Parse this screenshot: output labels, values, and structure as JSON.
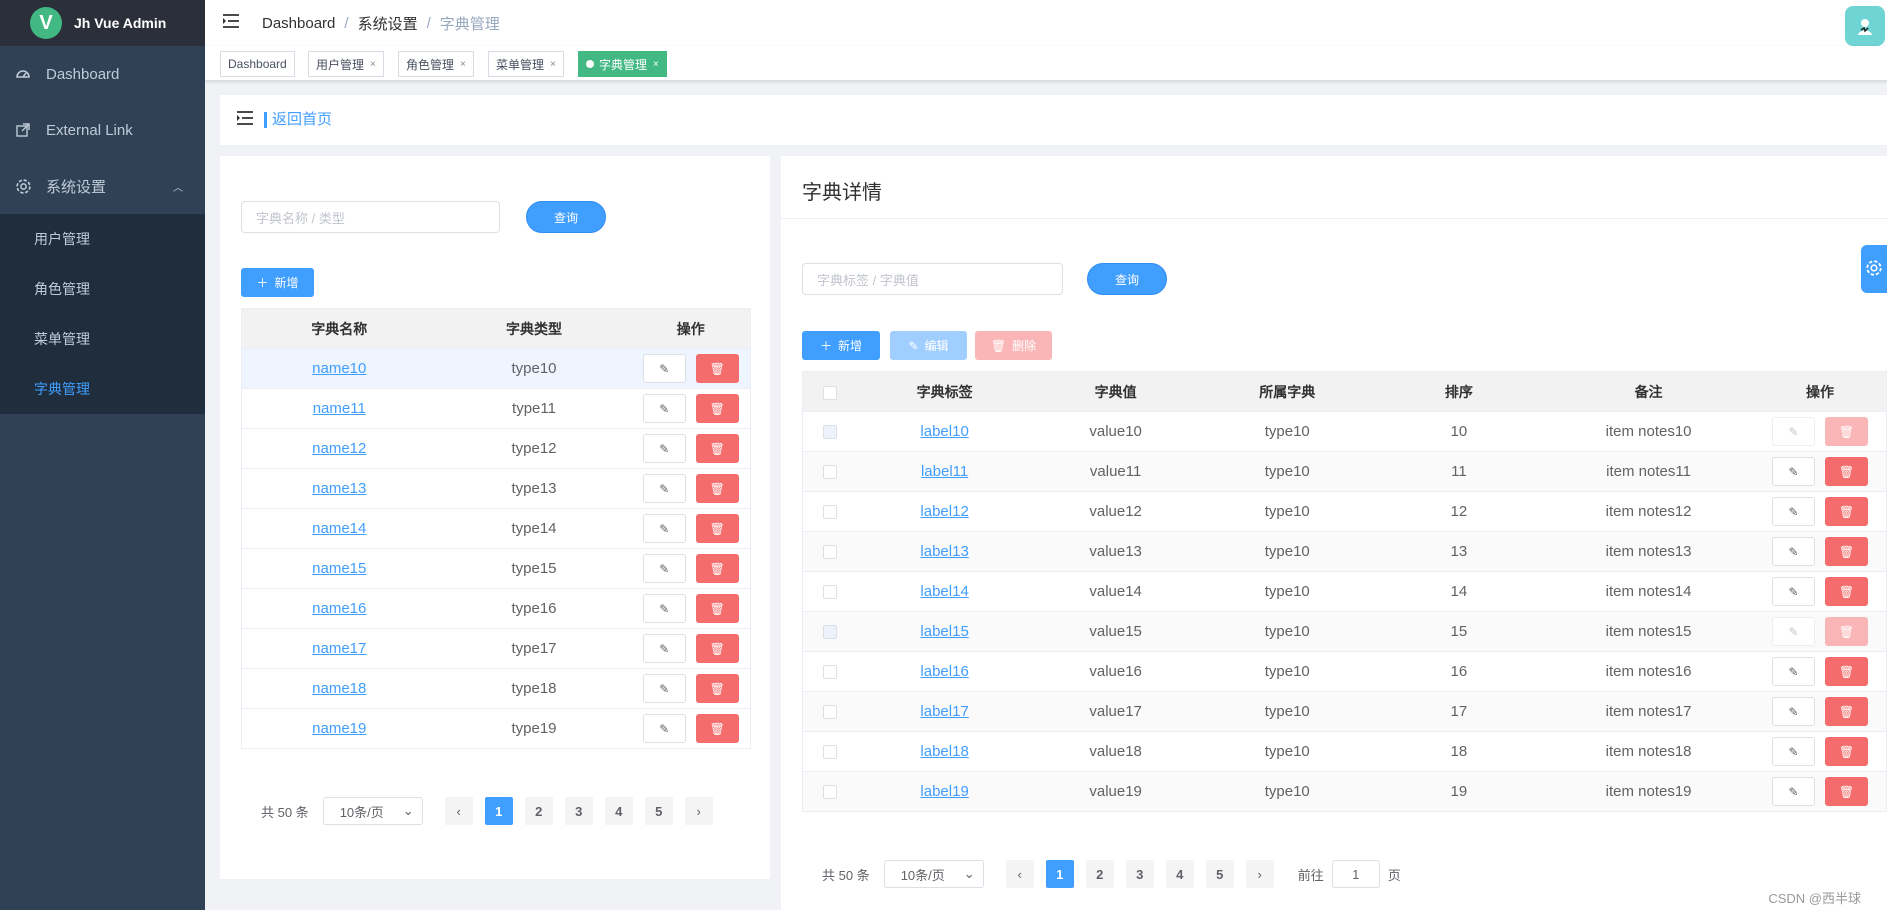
{
  "app": {
    "title": "Jh Vue Admin",
    "logo_letter": "V"
  },
  "sidebar": {
    "items": [
      {
        "label": "Dashboard",
        "icon": "dashboard-icon"
      },
      {
        "label": "External Link",
        "icon": "external-link-icon"
      },
      {
        "label": "系统设置",
        "icon": "gear-icon"
      }
    ],
    "submenu": [
      {
        "label": "用户管理"
      },
      {
        "label": "角色管理"
      },
      {
        "label": "菜单管理"
      },
      {
        "label": "字典管理",
        "active": true
      }
    ]
  },
  "breadcrumb": [
    "Dashboard",
    "系统设置",
    "字典管理"
  ],
  "tags": [
    {
      "label": "Dashboard",
      "closable": false
    },
    {
      "label": "用户管理",
      "closable": true
    },
    {
      "label": "角色管理",
      "closable": true
    },
    {
      "label": "菜单管理",
      "closable": true
    },
    {
      "label": "字典管理",
      "closable": true,
      "active": true
    }
  ],
  "header": {
    "back_label": "返回首页"
  },
  "left_panel": {
    "search_placeholder": "字典名称 / 类型",
    "search_label": "查询",
    "add_label": "新增",
    "columns": [
      "字典名称",
      "字典类型",
      "操作"
    ],
    "rows": [
      {
        "name": "name10",
        "type": "type10"
      },
      {
        "name": "name11",
        "type": "type11"
      },
      {
        "name": "name12",
        "type": "type12"
      },
      {
        "name": "name13",
        "type": "type13"
      },
      {
        "name": "name14",
        "type": "type14"
      },
      {
        "name": "name15",
        "type": "type15"
      },
      {
        "name": "name16",
        "type": "type16"
      },
      {
        "name": "name17",
        "type": "type17"
      },
      {
        "name": "name18",
        "type": "type18"
      },
      {
        "name": "name19",
        "type": "type19"
      }
    ],
    "pagination": {
      "total": "共 50 条",
      "page_size": "10条/页",
      "pages": [
        "1",
        "2",
        "3",
        "4",
        "5"
      ],
      "current": "1"
    }
  },
  "right_panel": {
    "title": "字典详情",
    "search_placeholder": "字典标签 / 字典值",
    "search_label": "查询",
    "add_label": "新增",
    "edit_label": "编辑",
    "delete_label": "删除",
    "columns": [
      "字典标签",
      "字典值",
      "所属字典",
      "排序",
      "备注",
      "操作"
    ],
    "rows": [
      {
        "label": "label10",
        "value": "value10",
        "dict": "type10",
        "sort": "10",
        "notes": "item notes10",
        "disabled": true
      },
      {
        "label": "label11",
        "value": "value11",
        "dict": "type10",
        "sort": "11",
        "notes": "item notes11",
        "disabled": false
      },
      {
        "label": "label12",
        "value": "value12",
        "dict": "type10",
        "sort": "12",
        "notes": "item notes12",
        "disabled": false
      },
      {
        "label": "label13",
        "value": "value13",
        "dict": "type10",
        "sort": "13",
        "notes": "item notes13",
        "disabled": false
      },
      {
        "label": "label14",
        "value": "value14",
        "dict": "type10",
        "sort": "14",
        "notes": "item notes14",
        "disabled": false
      },
      {
        "label": "label15",
        "value": "value15",
        "dict": "type10",
        "sort": "15",
        "notes": "item notes15",
        "disabled": true
      },
      {
        "label": "label16",
        "value": "value16",
        "dict": "type10",
        "sort": "16",
        "notes": "item notes16",
        "disabled": false
      },
      {
        "label": "label17",
        "value": "value17",
        "dict": "type10",
        "sort": "17",
        "notes": "item notes17",
        "disabled": false
      },
      {
        "label": "label18",
        "value": "value18",
        "dict": "type10",
        "sort": "18",
        "notes": "item notes18",
        "disabled": false
      },
      {
        "label": "label19",
        "value": "value19",
        "dict": "type10",
        "sort": "19",
        "notes": "item notes19",
        "disabled": false
      }
    ],
    "pagination": {
      "total": "共 50 条",
      "page_size": "10条/页",
      "pages": [
        "1",
        "2",
        "3",
        "4",
        "5"
      ],
      "current": "1",
      "goto_prefix": "前往",
      "goto_value": "1",
      "goto_suffix": "页"
    }
  },
  "watermark": "CSDN @西半球",
  "colors": {
    "primary": "#409eff",
    "danger": "#f56c6c",
    "sidebar": "#304156",
    "active_tag": "#42b983"
  }
}
